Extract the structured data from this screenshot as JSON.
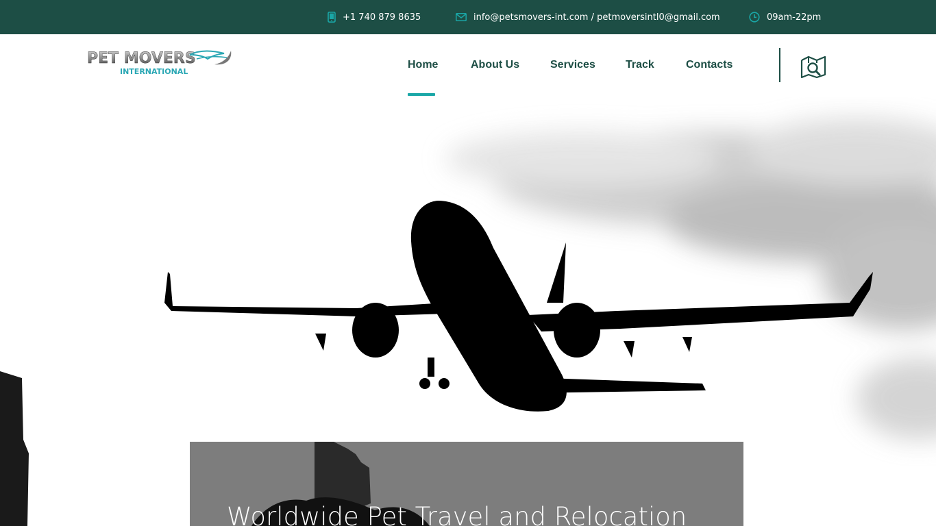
{
  "topbar": {
    "phone": "+1 740 879 8635",
    "email": "info@petsmovers-int.com / petmoversintl0@gmail.com",
    "hours": "09am-22pm",
    "phone_icon": "mobile-phone-icon",
    "email_icon": "envelope-icon",
    "hours_icon": "clock-icon",
    "background_color": "#1d4e45",
    "icon_color": "#1aa7a7"
  },
  "logo": {
    "line1": "PET MOVERS",
    "line2": "INTERNATIONAL"
  },
  "nav": {
    "items": [
      {
        "label": "Home",
        "active": true
      },
      {
        "label": "About Us",
        "active": false
      },
      {
        "label": "Services",
        "active": false
      },
      {
        "label": "Track",
        "active": false
      },
      {
        "label": "Contacts",
        "active": false
      }
    ],
    "accent_color": "#1aa7a7",
    "text_color": "#1d4e45",
    "map_icon": "map-search-icon"
  },
  "hero": {
    "title": "Worldwide Pet Travel and Relocation",
    "image": "airplane-silhouette-takeoff"
  }
}
